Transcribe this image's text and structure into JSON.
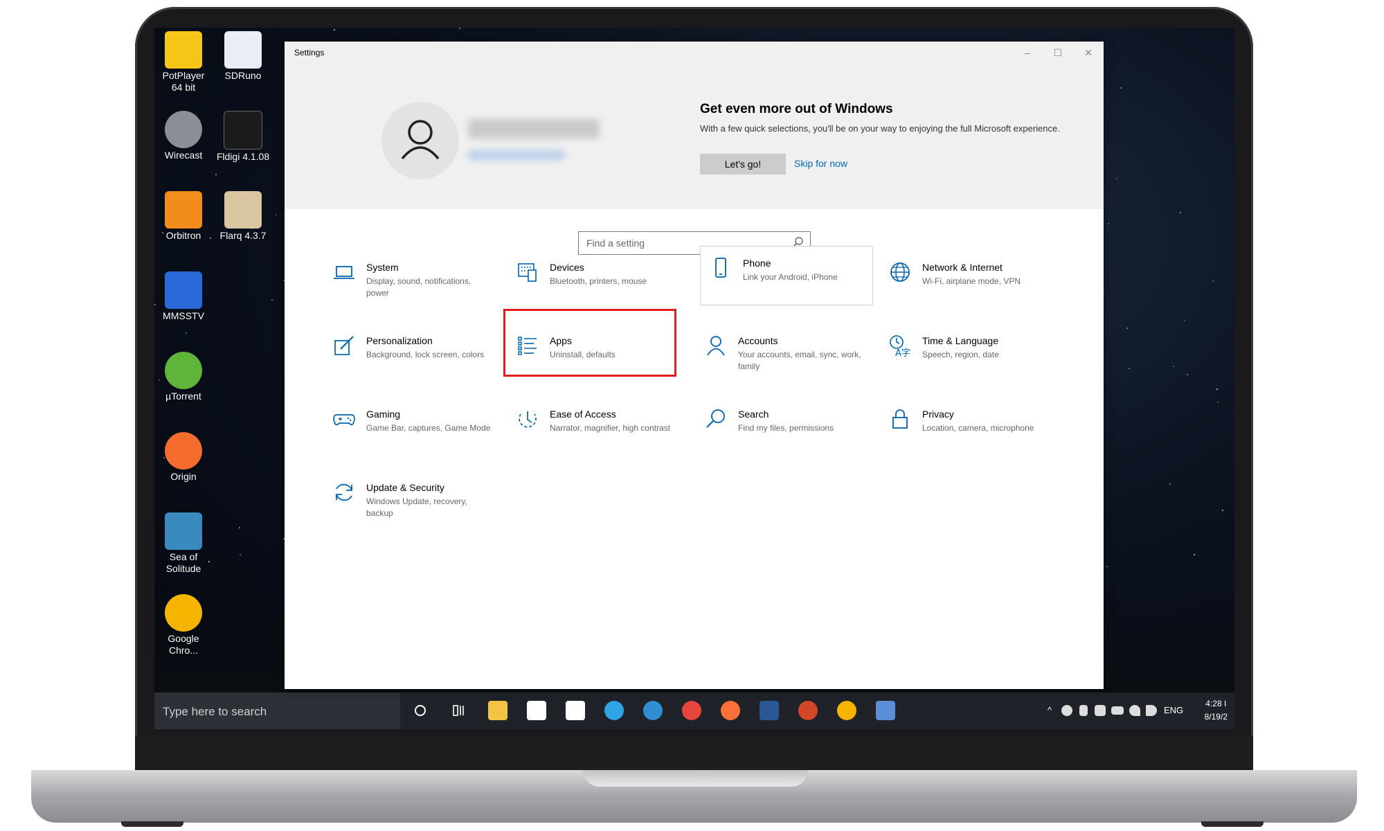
{
  "desktop": {
    "icons": [
      {
        "label": "PotPlayer 64 bit",
        "color": "#f5c518"
      },
      {
        "label": "SDRuno",
        "color": "#e9eef5"
      },
      {
        "label": "Wirecast",
        "color": "#8a8f96"
      },
      {
        "label": "Fldigi 4.1.08",
        "color": "#1b1b1b"
      },
      {
        "label": "Orbitron",
        "color": "#f28c1a"
      },
      {
        "label": "Flarq 4.3.7",
        "color": "#d9c6a0"
      },
      {
        "label": "MMSSTV",
        "color": "#2a6ad8"
      },
      {
        "label": "µTorrent",
        "color": "#5fb53a"
      },
      {
        "label": "Origin",
        "color": "#f56c2d"
      },
      {
        "label": "Sea of Solitude",
        "color": "#3a8ac0"
      },
      {
        "label": "Google Chro...",
        "color": "#f4b400"
      }
    ]
  },
  "window": {
    "title": "Settings",
    "controls": {
      "minimize": "–",
      "maximize": "☐",
      "close": "✕"
    }
  },
  "banner": {
    "title": "Get even more out of Windows",
    "description": "With a few quick selections, you'll be on your way to enjoying the full Microsoft experience.",
    "primary_button": "Let's go!",
    "secondary_link": "Skip for now"
  },
  "search": {
    "placeholder": "Find a setting"
  },
  "categories": [
    {
      "name": "System",
      "desc": "Display, sound, notifications, power",
      "icon": "laptop-icon"
    },
    {
      "name": "Devices",
      "desc": "Bluetooth, printers, mouse",
      "icon": "keyboard-icon"
    },
    {
      "name": "Phone",
      "desc": "Link your Android, iPhone",
      "icon": "phone-icon"
    },
    {
      "name": "Network & Internet",
      "desc": "Wi-Fi, airplane mode, VPN",
      "icon": "globe-icon"
    },
    {
      "name": "Personalization",
      "desc": "Background, lock screen, colors",
      "icon": "paint-icon"
    },
    {
      "name": "Apps",
      "desc": "Uninstall, defaults",
      "icon": "apps-list-icon"
    },
    {
      "name": "Accounts",
      "desc": "Your accounts, email, sync, work, family",
      "icon": "person-icon"
    },
    {
      "name": "Time & Language",
      "desc": "Speech, region, date",
      "icon": "time-language-icon"
    },
    {
      "name": "Gaming",
      "desc": "Game Bar, captures, Game Mode",
      "icon": "gamepad-icon"
    },
    {
      "name": "Ease of Access",
      "desc": "Narrator, magnifier, high contrast",
      "icon": "ease-of-access-icon"
    },
    {
      "name": "Search",
      "desc": "Find my files, permissions",
      "icon": "magnifier-icon"
    },
    {
      "name": "Privacy",
      "desc": "Location, camera, microphone",
      "icon": "lock-icon"
    },
    {
      "name": "Update & Security",
      "desc": "Windows Update, recovery, backup",
      "icon": "refresh-icon"
    }
  ],
  "taskbar": {
    "search_placeholder": "Type here to search",
    "apps": [
      {
        "name": "explorer",
        "color": "#f3c343"
      },
      {
        "name": "store",
        "color": "#ffffff"
      },
      {
        "name": "mail",
        "color": "#ffffff"
      },
      {
        "name": "edge",
        "color": "#2fa3e3"
      },
      {
        "name": "edge-dev",
        "color": "#2f8fd0"
      },
      {
        "name": "chrome",
        "color": "#e8453c"
      },
      {
        "name": "firefox",
        "color": "#ff7139"
      },
      {
        "name": "word",
        "color": "#2b5797"
      },
      {
        "name": "powerpoint",
        "color": "#d24726"
      },
      {
        "name": "chrome-canary",
        "color": "#f4b400"
      },
      {
        "name": "remote",
        "color": "#5a8fd8"
      }
    ],
    "language": "ENG",
    "time": "4:28 I",
    "date": "8/19/2"
  }
}
